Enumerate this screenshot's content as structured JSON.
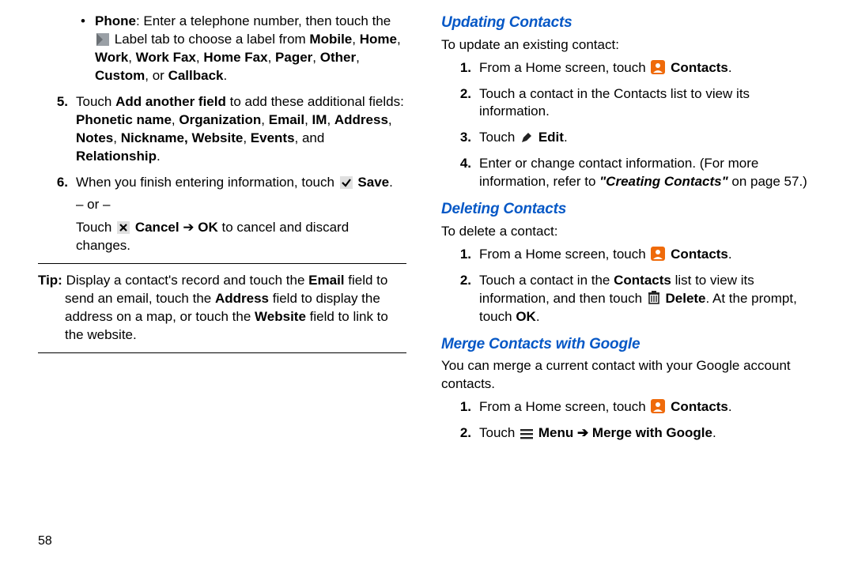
{
  "left": {
    "bullet_phone": {
      "lead": "Phone",
      "t1": ": Enter a telephone number, then touch the ",
      "labelword": "Label",
      "t2": "tab to choose a label from ",
      "opts1": "Mobile",
      "c1": ", ",
      "opts2": "Home",
      "c2": ", ",
      "opts3": "Work",
      "c3": ", ",
      "opts4": "Work Fax",
      "c4": ", ",
      "opts5": "Home Fax",
      "c5": ", ",
      "opts6": "Pager",
      "c6": ", ",
      "opts7": "Other",
      "c7": ", ",
      "opts8": "Custom",
      "c8": ", or ",
      "opts9": "Callback",
      "dot": "."
    },
    "step5": {
      "num": "5.",
      "t1": "Touch ",
      "bold1": "Add another field",
      "t2": " to add these additional fields: ",
      "list": "Phonetic name",
      "c1": ", ",
      "l2": "Organization",
      "c2": ", ",
      "l3": "Email",
      "c3": ", ",
      "l4": "IM",
      "c4": ", ",
      "l5": "Address",
      "c5": ", ",
      "l6": "Notes",
      "c6": ", ",
      "l7": "Nickname, Website",
      "c7": ", ",
      "l8": "Events",
      "c8": ", and ",
      "l9": "Relationship",
      "dot": "."
    },
    "step6": {
      "num": "6.",
      "t1": "When you finish entering information, touch ",
      "save": "Save",
      "dot": ".",
      "or": "– or –",
      "t2a": "Touch ",
      "cancel": "Cancel",
      "arrow": " ➔ ",
      "ok": "OK",
      "t2b": " to cancel and discard changes."
    },
    "tip": {
      "lead": "Tip:",
      "t1": " Display a contact's record and touch the ",
      "email": "Email",
      "t2": " field to send an email, touch the ",
      "addr": "Address",
      "t3": " field to display the address on a map, or touch the ",
      "web": "Website",
      "t4": " field to link to the website."
    },
    "pagenum": "58"
  },
  "right": {
    "h1": "Updating Contacts",
    "update_intro": "To update an existing contact:",
    "u1": {
      "num": "1.",
      "t1": "From a Home screen, touch ",
      "contacts": "Contacts",
      "dot": "."
    },
    "u2": {
      "num": "2.",
      "t": "Touch a contact in the Contacts list to view its information."
    },
    "u3": {
      "num": "3.",
      "t1": "Touch ",
      "edit": "Edit",
      "dot": "."
    },
    "u4": {
      "num": "4.",
      "t1": "Enter or change contact information. (For more information, refer to ",
      "ref": "\"Creating Contacts\"",
      "t2": " on page 57.)"
    },
    "h2": "Deleting Contacts",
    "delete_intro": "To delete a contact:",
    "d1": {
      "num": "1.",
      "t1": "From a Home screen, touch ",
      "contacts": "Contacts",
      "dot": "."
    },
    "d2": {
      "num": "2.",
      "t1": "Touch a contact in the ",
      "cl": "Contacts",
      "t2": " list to view its information, and then touch ",
      "del": "Delete",
      "t3": ". At the prompt, touch ",
      "ok": "OK",
      "dot": "."
    },
    "h3": "Merge Contacts with Google",
    "merge_intro": "You can merge a current contact with your Google account contacts.",
    "m1": {
      "num": "1.",
      "t1": "From a Home screen, touch ",
      "contacts": "Contacts",
      "dot": "."
    },
    "m2": {
      "num": "2.",
      "t1": "Touch ",
      "menu": "Menu",
      "arrow": " ➔ ",
      "mg": "Merge with Google",
      "dot": "."
    }
  }
}
